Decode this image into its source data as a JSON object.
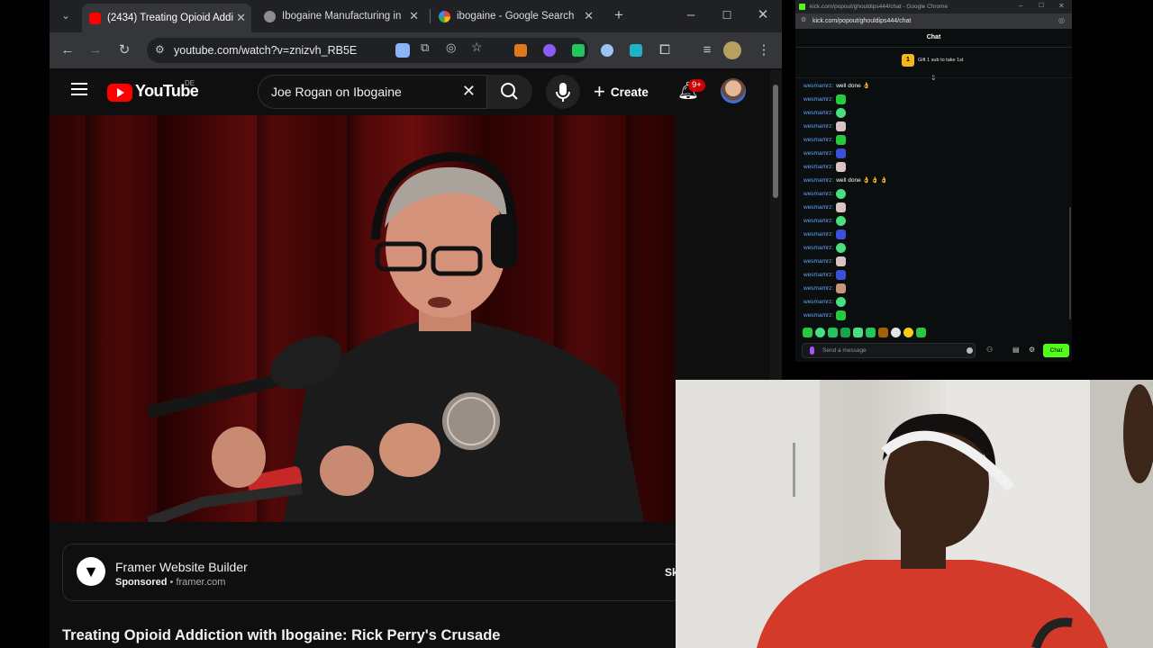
{
  "browser": {
    "tabs": [
      {
        "title": "(2434) Treating Opioid Addi",
        "active": true
      },
      {
        "title": "Ibogaine Manufacturing in",
        "active": false
      },
      {
        "title": "ibogaine - Google Search",
        "active": false
      }
    ],
    "url": "youtube.com/watch?v=znizvh_RB5E",
    "new_tab": "+"
  },
  "youtube": {
    "logo_text": "YouTube",
    "region": "DE",
    "search_value": "Joe Rogan on Ibogaine",
    "create_label": "Create",
    "notification_count": "9+",
    "ad": {
      "title": "Framer Website Builder",
      "sponsored": "Sponsored",
      "domain": "framer.com",
      "button_partial": "Sk"
    },
    "video_title": "Treating Opioid Addiction with Ibogaine: Rick Perry's Crusade"
  },
  "kick": {
    "window_title": "kick.com/popout/ghouldips444/chat - Google Chrome",
    "url": "kick.com/popout/ghouldips444/chat",
    "header": "Chat",
    "gift_count": "1",
    "gift_text": "Gift 1 sub to take 1st",
    "messages": [
      {
        "user": "wesmamrz:",
        "text": "well done 👌"
      },
      {
        "user": "wesmamrz:",
        "text": ""
      },
      {
        "user": "wesmamrz:",
        "text": ""
      },
      {
        "user": "wesmamrz:",
        "text": ""
      },
      {
        "user": "wesmamrz:",
        "text": ""
      },
      {
        "user": "wesmamrz:",
        "text": ""
      },
      {
        "user": "wesmamrz:",
        "text": ""
      },
      {
        "user": "wesmamrz:",
        "text": "well done 👌 👌 👌"
      },
      {
        "user": "wesmamrz:",
        "text": ""
      },
      {
        "user": "wesmamrz:",
        "text": ""
      },
      {
        "user": "wesmamrz:",
        "text": ""
      },
      {
        "user": "wesmamrz:",
        "text": ""
      },
      {
        "user": "wesmamrz:",
        "text": ""
      },
      {
        "user": "wesmamrz:",
        "text": ""
      },
      {
        "user": "wesmamrz:",
        "text": ""
      },
      {
        "user": "wesmamrz:",
        "text": ""
      },
      {
        "user": "wesmamrz:",
        "text": ""
      },
      {
        "user": "wesmamrz:",
        "text": ""
      }
    ],
    "input_placeholder": "Send a message",
    "chat_button": "Chat"
  },
  "colors": {
    "youtube_red": "#ff0000",
    "kick_green": "#53fc18",
    "username_blue": "#60a5fa",
    "notification_red": "#cc0000"
  }
}
